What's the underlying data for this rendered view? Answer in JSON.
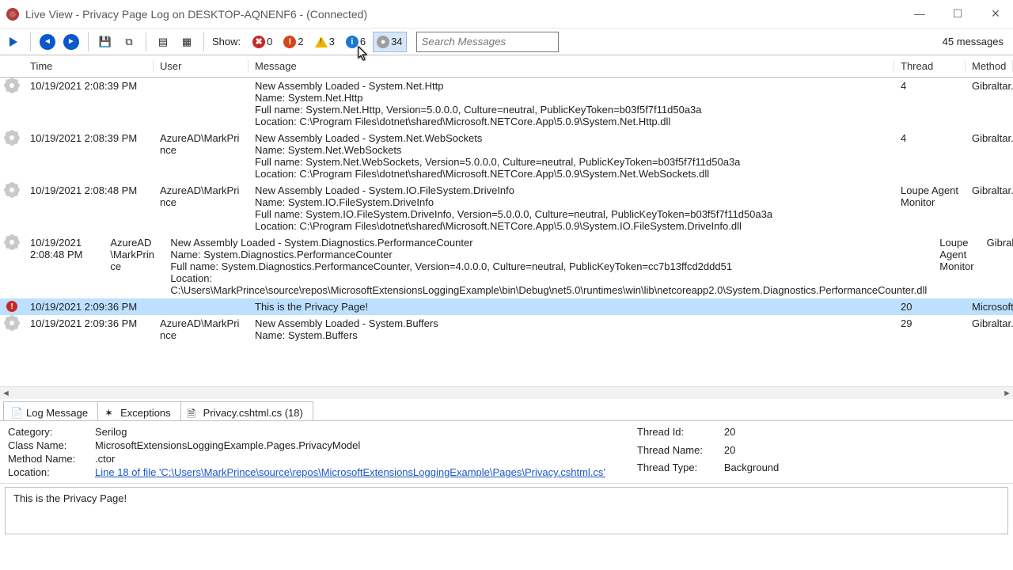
{
  "window": {
    "title": "Live View - Privacy Page Log on DESKTOP-AQNENF6 - (Connected)"
  },
  "toolbar": {
    "show_label": "Show:",
    "filters": {
      "error": {
        "count": "0"
      },
      "critical": {
        "count": "2"
      },
      "warning": {
        "count": "3"
      },
      "info": {
        "count": "6"
      },
      "debug": {
        "count": "34"
      }
    },
    "search_placeholder": "Search Messages",
    "msg_count": "45 messages"
  },
  "grid": {
    "headers": {
      "time": "Time",
      "user": "User",
      "message": "Message",
      "thread": "Thread",
      "method": "Method"
    },
    "rows": [
      {
        "icon": "gear",
        "time": "10/19/2021 2:08:39 PM",
        "user": "",
        "message": "New Assembly Loaded - System.Net.Http\nName: System.Net.Http\nFull name: System.Net.Http, Version=5.0.0.0, Culture=neutral, PublicKeyToken=b03f5f7f11d50a3a\nLocation: C:\\Program Files\\dotnet\\shared\\Microsoft.NETCore.App\\5.0.9\\System.Net.Http.dll",
        "thread": "4",
        "method": "Gibraltar.Agent.LogEvent"
      },
      {
        "icon": "gear",
        "time": "10/19/2021 2:08:39 PM",
        "user": "AzureAD\\MarkPrince",
        "message": "New Assembly Loaded - System.Net.WebSockets\nName: System.Net.WebSockets\nFull name: System.Net.WebSockets, Version=5.0.0.0, Culture=neutral, PublicKeyToken=b03f5f7f11d50a3a\nLocation: C:\\Program Files\\dotnet\\shared\\Microsoft.NETCore.App\\5.0.9\\System.Net.WebSockets.dll",
        "thread": "4",
        "method": "Gibraltar.Agent.LogEvent"
      },
      {
        "icon": "gear",
        "time": "10/19/2021 2:08:48 PM",
        "user": "AzureAD\\MarkPrince",
        "message": "New Assembly Loaded - System.IO.FileSystem.DriveInfo\nName: System.IO.FileSystem.DriveInfo\nFull name: System.IO.FileSystem.DriveInfo, Version=5.0.0.0, Culture=neutral, PublicKeyToken=b03f5f7f11d50a3a\nLocation: C:\\Program Files\\dotnet\\shared\\Microsoft.NETCore.App\\5.0.9\\System.IO.FileSystem.DriveInfo.dll",
        "thread": "Loupe Agent Monitor",
        "method": "Gibraltar.Agent.LogEvent"
      },
      {
        "icon": "gear",
        "time": "10/19/2021 2:08:48 PM",
        "user": "AzureAD\\MarkPrince",
        "message": "New Assembly Loaded - System.Diagnostics.PerformanceCounter\nName: System.Diagnostics.PerformanceCounter\nFull name: System.Diagnostics.PerformanceCounter, Version=4.0.0.0, Culture=neutral, PublicKeyToken=cc7b13ffcd2ddd51\nLocation: C:\\Users\\MarkPrince\\source\\repos\\MicrosoftExtensionsLoggingExample\\bin\\Debug\\net5.0\\runtimes\\win\\lib\\netcoreapp2.0\\System.Diagnostics.PerformanceCounter.dll",
        "thread": "Loupe Agent Monitor",
        "method": "Gibraltar.Agent.LogEvent"
      },
      {
        "icon": "error",
        "selected": true,
        "time": "10/19/2021 2:09:36 PM",
        "user": "",
        "message": "This is the Privacy Page!",
        "thread": "20",
        "method": "Microsoft"
      },
      {
        "icon": "gear",
        "time": "10/19/2021 2:09:36 PM",
        "user": "AzureAD\\MarkPrince",
        "message": "New Assembly Loaded - System.Buffers\nName: System.Buffers",
        "thread": "29",
        "method": "Gibraltar.Agent.LogEvent"
      }
    ]
  },
  "tabs": {
    "log": "Log Message",
    "exc": "Exceptions",
    "file": "Privacy.cshtml.cs (18)"
  },
  "details": {
    "category_k": "Category:",
    "category_v": "Serilog",
    "class_k": "Class Name:",
    "class_v": "MicrosoftExtensionsLoggingExample.Pages.PrivacyModel",
    "method_k": "Method Name:",
    "method_v": ".ctor",
    "location_k": "Location:",
    "location_v": "Line 18 of file 'C:\\Users\\MarkPrince\\source\\repos\\MicrosoftExtensionsLoggingExample\\Pages\\Privacy.cshtml.cs'",
    "threadid_k": "Thread Id:",
    "threadid_v": "20",
    "threadnm_k": "Thread Name:",
    "threadnm_v": "20",
    "threadty_k": "Thread Type:",
    "threadty_v": "Background"
  },
  "message_body": "This is the Privacy Page!"
}
